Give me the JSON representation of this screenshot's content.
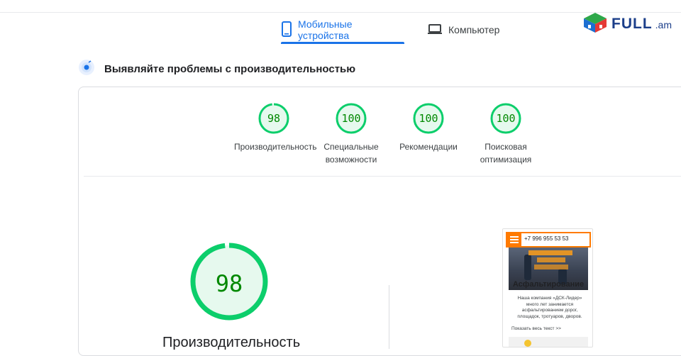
{
  "tabs": [
    {
      "label": "Мобильные устройства",
      "icon": "mobile-icon",
      "active": true
    },
    {
      "label": "Компьютер",
      "icon": "laptop-icon",
      "active": false
    }
  ],
  "logo": {
    "text": "FULL",
    "suffix": ".am",
    "icon": "house-cube-icon"
  },
  "section": {
    "title": "Выявляйте проблемы с производительностью",
    "icon": "gauge-pulse-icon"
  },
  "colors": {
    "pass": "#0cce6b",
    "pass_text": "#008800",
    "pass_fill": "#e6f9ee",
    "accent": "#1a73e8"
  },
  "scores": [
    {
      "score": "98",
      "value": 98,
      "label_line1": "Производительность",
      "label_line2": ""
    },
    {
      "score": "100",
      "value": 100,
      "label_line1": "Специальные",
      "label_line2": "возможности"
    },
    {
      "score": "100",
      "value": 100,
      "label_line1": "Рекомендации",
      "label_line2": ""
    },
    {
      "score": "100",
      "value": 100,
      "label_line1": "Поисковая",
      "label_line2": "оптимизация"
    }
  ],
  "main_score": {
    "score": "98",
    "value": 98,
    "label": "Производительность"
  },
  "preview": {
    "phone": "+7 996 955 53 53",
    "title": "Асфальтирование",
    "text": "Наша компания «ДСК-Лидер» много лет занимается асфальтированием дорог, площадок, тротуаров, дворов.",
    "more": "Показать весь текст >>"
  }
}
